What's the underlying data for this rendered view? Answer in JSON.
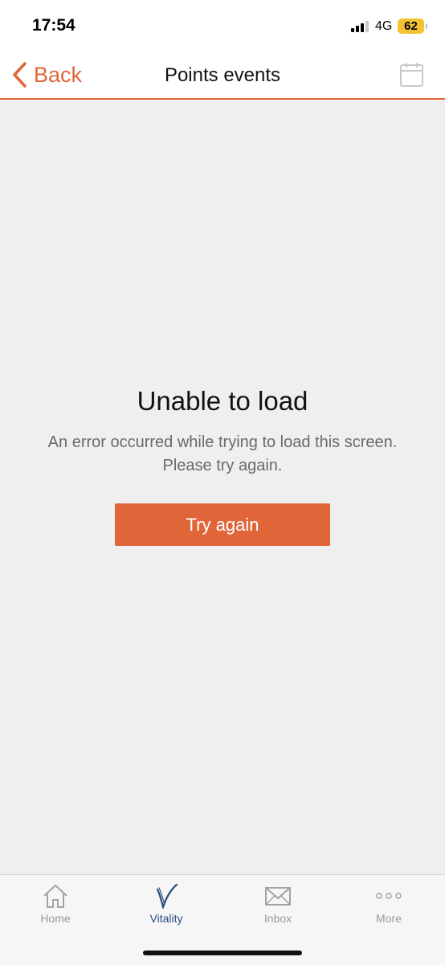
{
  "status_bar": {
    "time": "17:54",
    "network": "4G",
    "battery": "62"
  },
  "nav": {
    "back_label": "Back",
    "title": "Points events"
  },
  "error": {
    "title": "Unable to load",
    "message_line1": "An error occurred while trying to load this screen.",
    "message_line2": "Please try again.",
    "retry_label": "Try again"
  },
  "tabs": [
    {
      "label": "Home",
      "icon": "home-icon",
      "active": false
    },
    {
      "label": "Vitality",
      "icon": "vitality-icon",
      "active": true
    },
    {
      "label": "Inbox",
      "icon": "inbox-icon",
      "active": false
    },
    {
      "label": "More",
      "icon": "more-icon",
      "active": false
    }
  ],
  "colors": {
    "accent": "#e0663a",
    "active_tab": "#2a4f7d",
    "background": "#efefef"
  }
}
